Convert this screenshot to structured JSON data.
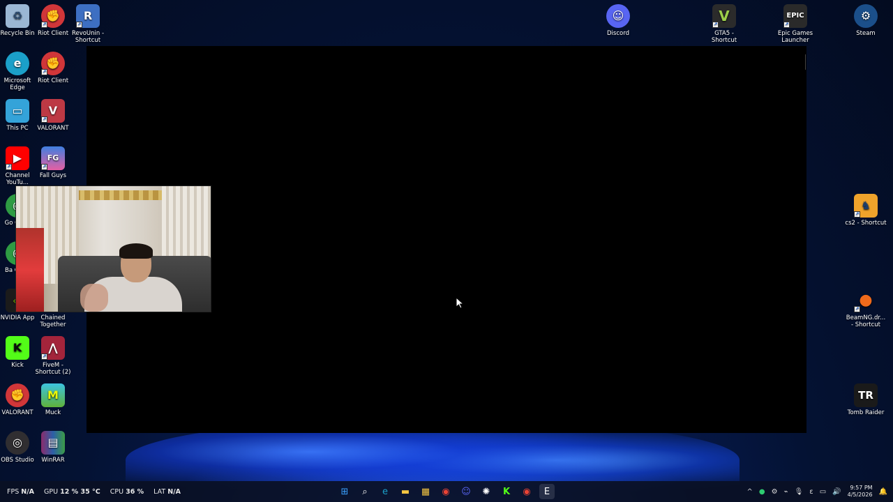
{
  "desktop": {
    "left_icons": [
      {
        "label": "Recycle Bin",
        "icon": "recycle-bin-icon",
        "color": "#9bb7d4"
      },
      {
        "label": "Riot Client",
        "icon": "riot-client-icon",
        "color": "#d13639"
      },
      {
        "label": "RevoUnin - Shortcut",
        "icon": "revo-uninstaller-icon",
        "color": "#3d6fc2"
      },
      {
        "label": "Microsoft Edge",
        "icon": "edge-icon",
        "color": "#1ba0c9"
      },
      {
        "label": "Riot Client",
        "icon": "riot-client-icon",
        "color": "#d13639"
      },
      {
        "label": "This PC",
        "icon": "monitor-icon",
        "color": "#34a3d9"
      },
      {
        "label": "VALORANT",
        "icon": "valorant-icon",
        "color": "#bd3944"
      },
      {
        "label": "Channel YouTu...",
        "icon": "youtube-icon",
        "color": "#ff0000"
      },
      {
        "label": "Fall Guys",
        "icon": "fall-guys-icon",
        "color": "#3f7fe0"
      },
      {
        "label": "Go Chr...",
        "icon": "chrome-icon",
        "color": "#2e9b43"
      },
      {
        "label": "Ba Chr...",
        "icon": "chrome-icon",
        "color": "#2e9b43"
      },
      {
        "label": "NVIDIA App",
        "icon": "nvidia-icon",
        "color": "#76b900"
      },
      {
        "label": "Chained Together",
        "icon": "chained-together-icon",
        "color": "#6b4a2f"
      },
      {
        "label": "Kick",
        "icon": "kick-icon",
        "color": "#53fc18"
      },
      {
        "label": "FiveM - Shortcut (2)",
        "icon": "fivem-icon",
        "color": "#a3243b"
      },
      {
        "label": "VALORANT",
        "icon": "riot-client-icon",
        "color": "#d13639"
      },
      {
        "label": "Muck",
        "icon": "muck-icon",
        "color": "#5fb23a"
      },
      {
        "label": "OBS Studio",
        "icon": "obs-icon",
        "color": "#302e31"
      },
      {
        "label": "WinRAR",
        "icon": "winrar-icon",
        "color": "#8a2c6c"
      }
    ],
    "right_icons": [
      {
        "label": "Discord",
        "icon": "discord-icon",
        "color": "#5865f2"
      },
      {
        "label": "GTA5 - Shortcut",
        "icon": "gta5-icon",
        "color": "#2b2b2b"
      },
      {
        "label": "Epic Games Launcher",
        "icon": "epic-games-icon",
        "color": "#2a2a2a"
      },
      {
        "label": "Steam",
        "icon": "steam-icon",
        "color": "#1b4f8a"
      },
      {
        "label": "cs2 - Shortcut",
        "icon": "cs2-icon",
        "color": "#f0a32b"
      },
      {
        "label": "BeamNG.dr... - Shortcut",
        "icon": "beamng-icon",
        "color": "#f06a1b"
      },
      {
        "label": "Tomb Raider",
        "icon": "tomb-raider-icon",
        "color": "#1a1a1a"
      }
    ]
  },
  "glyphs": {
    "recycle": "♻",
    "riot": "✊",
    "revo": "R",
    "edge": "e",
    "pc": "▭",
    "valorant": "V",
    "youtube": "▶",
    "fallguys": "FG",
    "chrome": "◉",
    "nvidia": "◈",
    "chained": "⛓",
    "kick": "K",
    "fivem": "⋀",
    "muck": "M",
    "obs": "◎",
    "winrar": "▤",
    "discord": "☺",
    "gta": "V",
    "epic": "EPIC",
    "steam": "⚙",
    "cs2": "♞",
    "beamng": "●",
    "tombraider": "TR"
  },
  "taskbar": {
    "stats": {
      "fps_label": "FPS",
      "fps_value": "N/A",
      "gpu_label": "GPU",
      "gpu_value": "12 % 35 °C",
      "cpu_label": "CPU",
      "cpu_value": "36 %",
      "lat_label": "LAT",
      "lat_value": "N/A"
    },
    "pinned": [
      {
        "name": "start-icon",
        "glyph": "⊞",
        "color": "#3aa0ff"
      },
      {
        "name": "search-icon",
        "glyph": "⌕",
        "color": "#ffffff"
      },
      {
        "name": "edge-icon",
        "glyph": "e",
        "color": "#1ba0c9"
      },
      {
        "name": "file-explorer-icon",
        "glyph": "▬",
        "color": "#f4c542"
      },
      {
        "name": "microsoft-store-icon",
        "glyph": "▦",
        "color": "#f4c542"
      },
      {
        "name": "chrome-icon",
        "glyph": "◉",
        "color": "#ea4335"
      },
      {
        "name": "discord-icon",
        "glyph": "☺",
        "color": "#5865f2"
      },
      {
        "name": "chatgpt-icon",
        "glyph": "✺",
        "color": "#ffffff"
      },
      {
        "name": "kick-icon",
        "glyph": "K",
        "color": "#53fc18"
      },
      {
        "name": "chrome-icon",
        "glyph": "◉",
        "color": "#ea4335"
      },
      {
        "name": "epic-games-icon",
        "glyph": "E",
        "color": "#ffffff"
      }
    ],
    "tray": {
      "chevron": "^",
      "time": "9:57 PM",
      "date": "4/5/2026"
    }
  }
}
